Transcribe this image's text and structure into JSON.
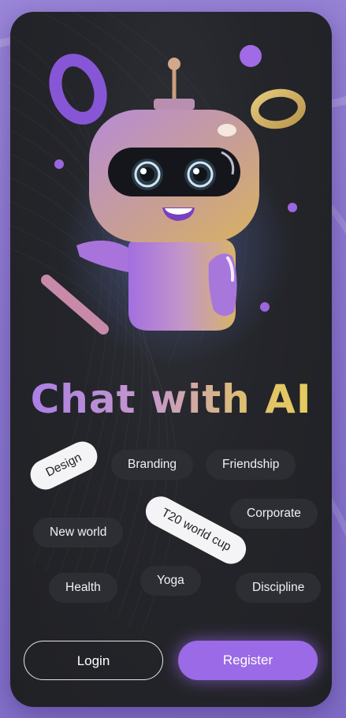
{
  "title": "Chat with AI",
  "tags": [
    {
      "label": "Design"
    },
    {
      "label": "Branding"
    },
    {
      "label": "Friendship"
    },
    {
      "label": "Corporate"
    },
    {
      "label": "T20 world cup"
    },
    {
      "label": "New world"
    },
    {
      "label": "Health"
    },
    {
      "label": "Yoga"
    },
    {
      "label": "Discipline"
    }
  ],
  "buttons": {
    "login": "Login",
    "register": "Register"
  },
  "colors": {
    "accent": "#9b6ae6",
    "card_bg": "#24252a",
    "tag_bg": "#2d2e33",
    "title_gradient_start": "#a77bea",
    "title_gradient_end": "#e8cf5a"
  }
}
